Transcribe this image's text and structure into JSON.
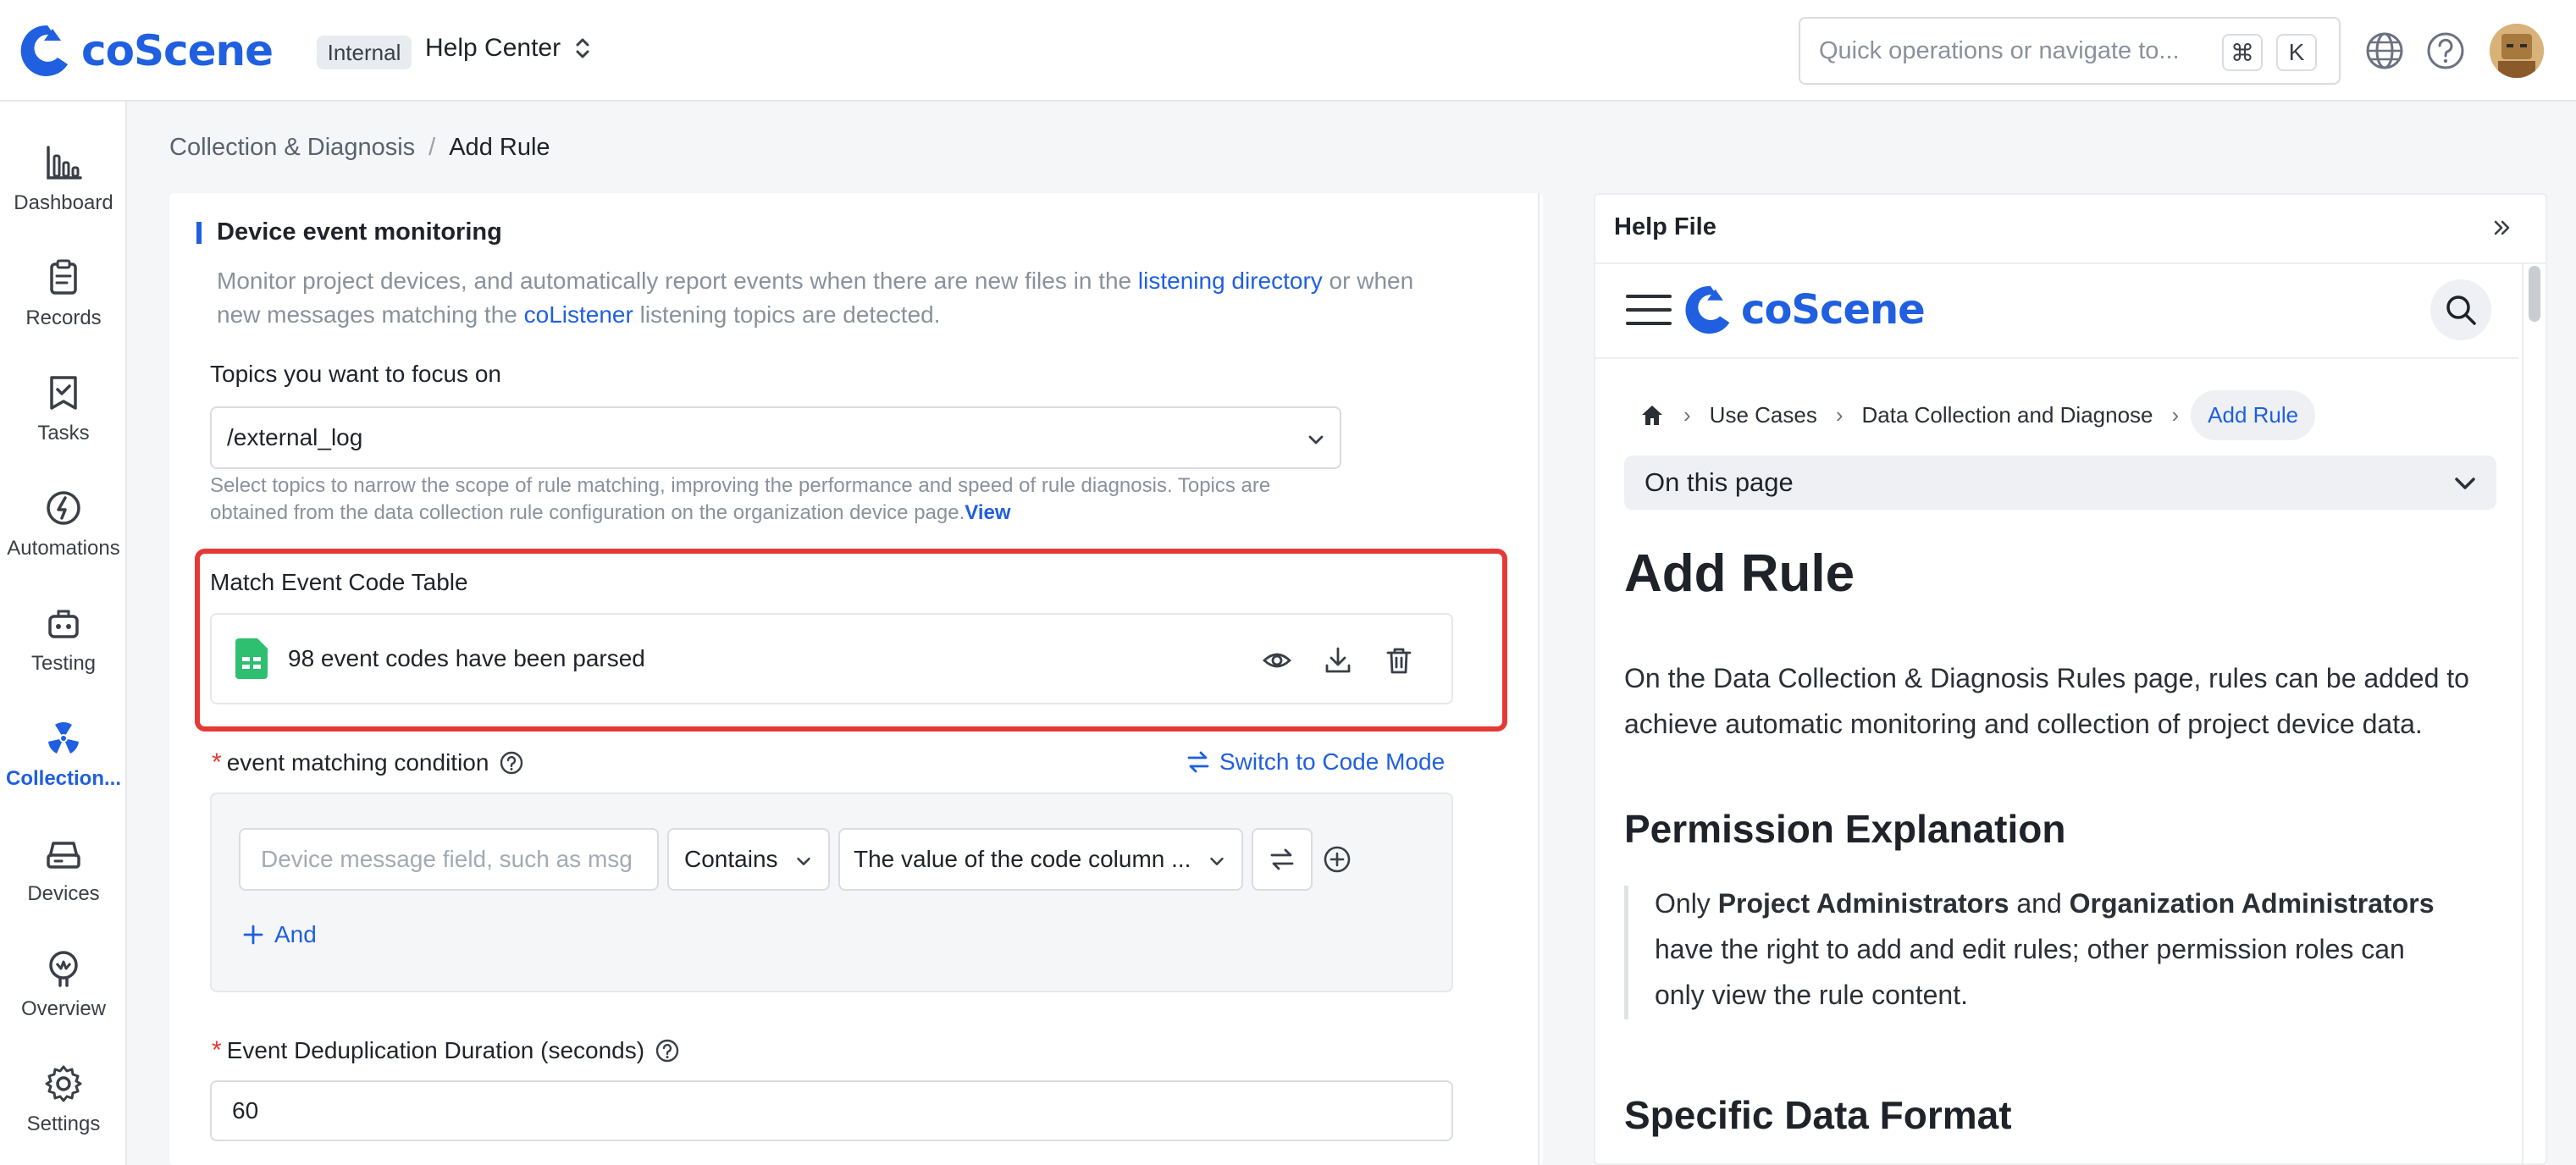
{
  "header": {
    "logo_text": "coScene",
    "org_badge": "Internal",
    "project_name": "Help Center",
    "search_placeholder": "Quick operations or navigate to...",
    "shortcut_keys": [
      "⌘",
      "K"
    ]
  },
  "sidebar": {
    "items": [
      {
        "label": "Dashboard",
        "icon": "bar-chart-icon"
      },
      {
        "label": "Records",
        "icon": "clipboard-icon"
      },
      {
        "label": "Tasks",
        "icon": "task-icon"
      },
      {
        "label": "Automations",
        "icon": "automation-icon"
      },
      {
        "label": "Testing",
        "icon": "testing-icon"
      },
      {
        "label": "Collection...",
        "icon": "radiation-icon",
        "active": true
      },
      {
        "label": "Devices",
        "icon": "device-icon"
      },
      {
        "label": "Overview",
        "icon": "overview-icon"
      },
      {
        "label": "Settings",
        "icon": "gear-icon"
      }
    ]
  },
  "breadcrumb": {
    "parent": "Collection & Diagnosis",
    "separator": "/",
    "current": "Add Rule"
  },
  "form": {
    "section_title": "Device event monitoring",
    "description_1": "Monitor project devices, and automatically report events when there are new files in the ",
    "description_link_1": "listening directory",
    "description_2": " or when",
    "description_3": "new messages matching the ",
    "description_link_2": "coListener",
    "description_4": " listening topics are detected.",
    "topics_label": "Topics you want to focus on",
    "topics_value": "/external_log",
    "topics_tip_1": "Select topics to narrow the scope of rule matching, improving the performance and speed of rule diagnosis. Topics are",
    "topics_tip_2": "obtained from the data collection rule configuration on the organization device page.",
    "topics_tip_link": "View",
    "match_table_label": "Match Event Code Table",
    "match_file_text": "98 event codes have been parsed",
    "condition_label": "event matching condition",
    "switch_mode_label": "Switch to Code Mode",
    "field_placeholder": "Device message field, such as msg",
    "operator_value": "Contains",
    "code_value": "The value of the code column ...",
    "and_label": "And",
    "dedup_label": "Event Deduplication Duration (seconds)",
    "dedup_value": "60"
  },
  "help": {
    "panel_title": "Help File",
    "doc_logo_text": "coScene",
    "crumbs": [
      "Use Cases",
      "Data Collection and Diagnose",
      "Add Rule"
    ],
    "on_this_page": "On this page",
    "title": "Add Rule",
    "intro_1": "On the Data Collection & Diagnosis Rules page, rules can be added to",
    "intro_2": "achieve automatic monitoring and collection of project device data.",
    "h2_permission": "Permission Explanation",
    "quote_only": "Only ",
    "quote_bold_1": "Project Administrators",
    "quote_and": " and ",
    "quote_bold_2": "Organization Administrators",
    "quote_line_2": "have the right to add and edit rules; other permission roles can",
    "quote_line_3": "only view the rule content.",
    "h2_format": "Specific Data Format"
  },
  "colors": {
    "brand": "#1f5fe0",
    "highlight_box": "#e53935",
    "file_icon": "#2fbf71"
  }
}
